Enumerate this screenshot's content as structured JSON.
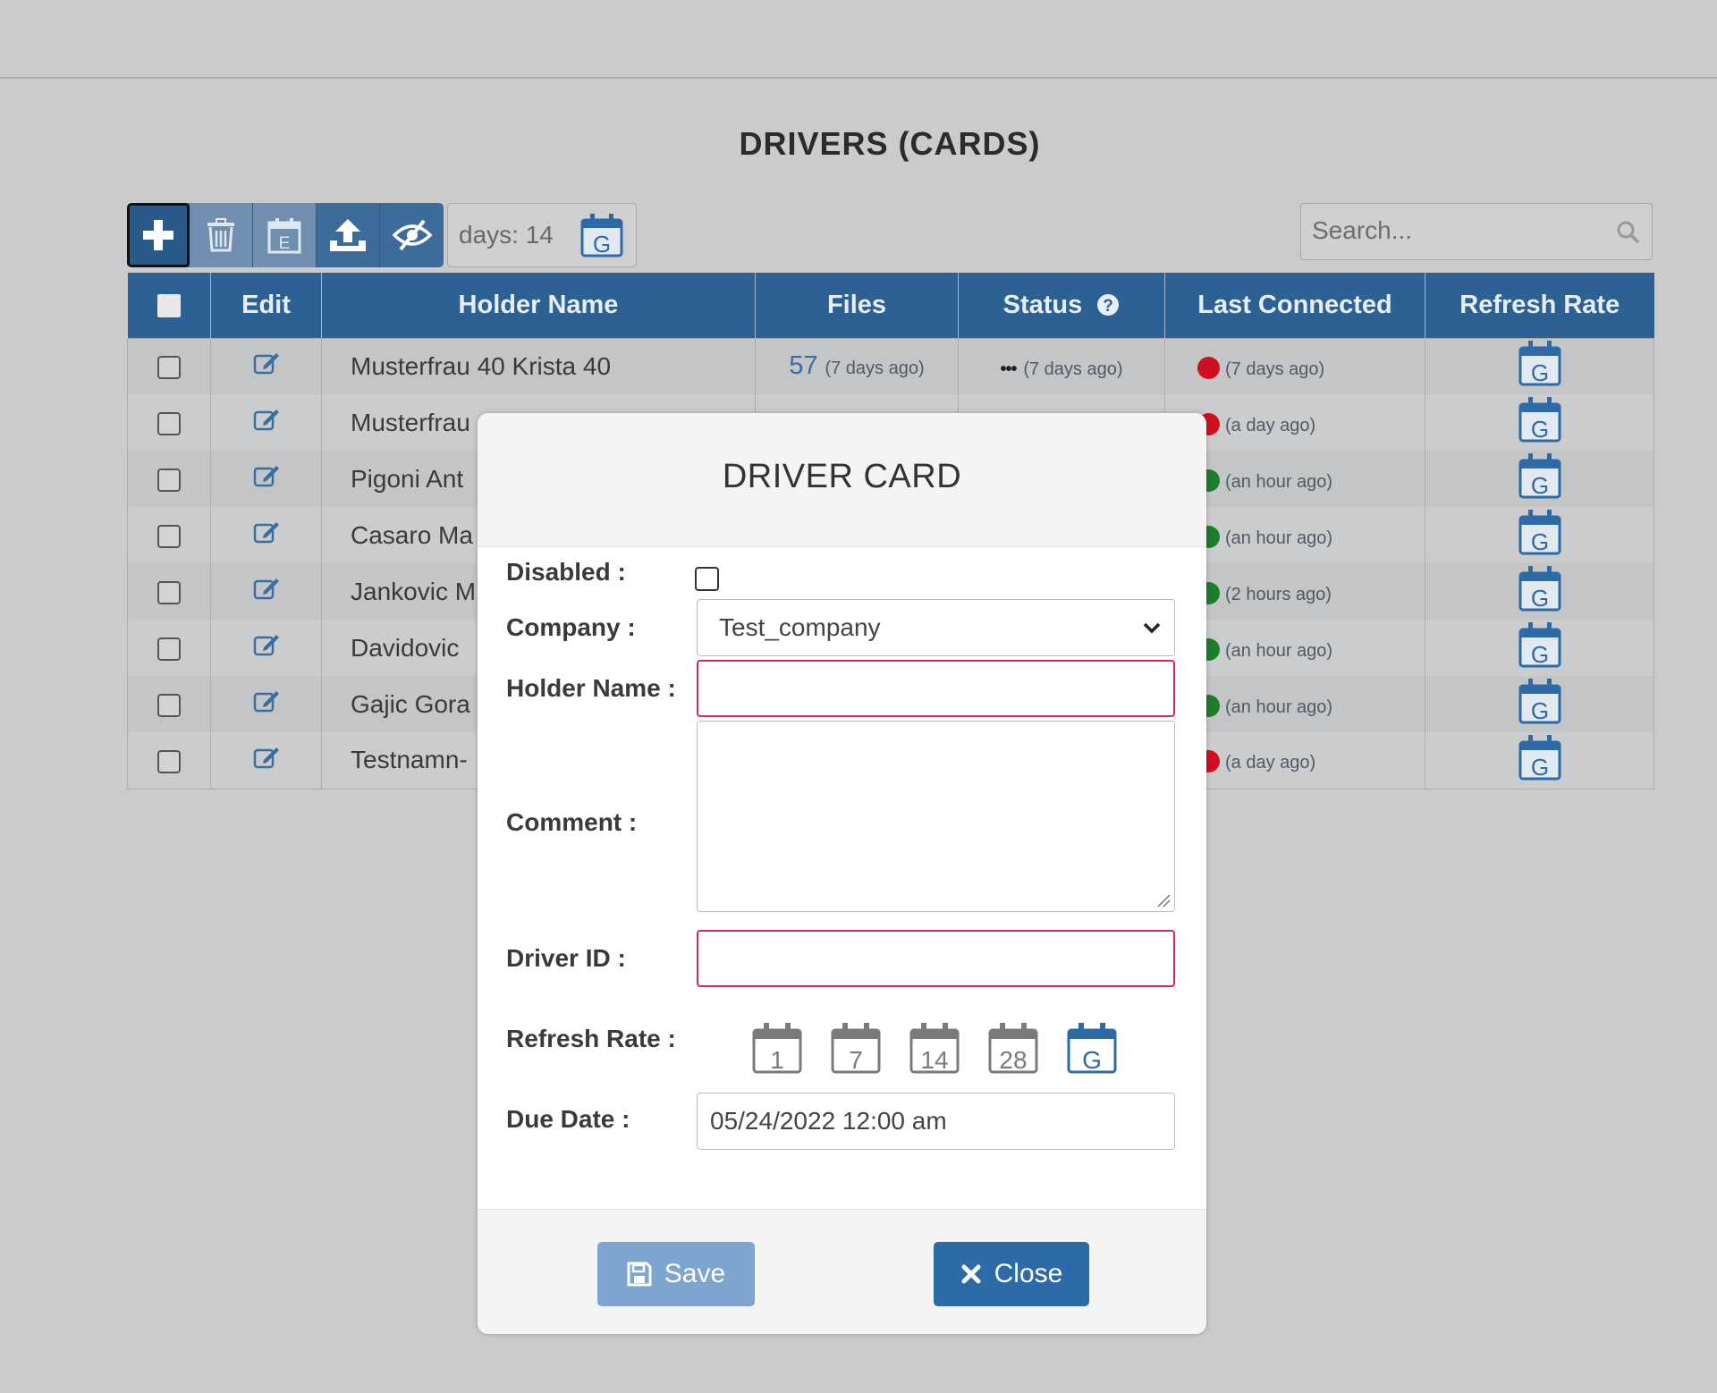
{
  "page": {
    "title": "DRIVERS (CARDS)"
  },
  "toolbar": {
    "days_label": "days: 14",
    "icons": [
      "plus-icon",
      "trash-icon",
      "calendar-e-icon",
      "upload-icon",
      "eye-slash-icon"
    ],
    "calendar_badge": "G"
  },
  "search": {
    "placeholder": "Search..."
  },
  "table": {
    "headers": [
      "Edit",
      "Holder Name",
      "Files",
      "Status",
      "Last Connected",
      "Refresh Rate"
    ],
    "refresh_badge": "G",
    "rows": [
      {
        "holder": "Musterfrau 40 Krista 40",
        "files": "57",
        "files_ago": "(7 days ago)",
        "status_ago": "(7 days ago)",
        "status_symbol": "•••",
        "last_ago": "(7 days ago)",
        "last_status": "red"
      },
      {
        "holder": "Musterfrau",
        "files": "",
        "files_ago": "",
        "status_ago": "",
        "status_symbol": "",
        "last_ago": "(a day ago)",
        "last_status": "red"
      },
      {
        "holder": "Pigoni Ant",
        "files": "",
        "files_ago": "",
        "status_ago": "",
        "status_symbol": "",
        "last_ago": "(an hour ago)",
        "last_status": "green"
      },
      {
        "holder": "Casaro Ma",
        "files": "",
        "files_ago": "",
        "status_ago": "",
        "status_symbol": "",
        "last_ago": "(an hour ago)",
        "last_status": "green"
      },
      {
        "holder": "Jankovic M",
        "files": "",
        "files_ago": "",
        "status_ago": "",
        "status_symbol": "",
        "last_ago": "(2 hours ago)",
        "last_status": "green"
      },
      {
        "holder": "Davidovic",
        "files": "",
        "files_ago": "",
        "status_ago": "",
        "status_symbol": "",
        "last_ago": "(an hour ago)",
        "last_status": "green"
      },
      {
        "holder": "Gajic Gora",
        "files": "",
        "files_ago": "",
        "status_ago": "",
        "status_symbol": "",
        "last_ago": "(an hour ago)",
        "last_status": "green"
      },
      {
        "holder": "Testnamn-",
        "files": "",
        "files_ago": "",
        "status_ago": "",
        "status_symbol": "",
        "last_ago": "(a day ago)",
        "last_status": "red"
      }
    ]
  },
  "modal": {
    "title": "DRIVER CARD",
    "labels": {
      "disabled": "Disabled :",
      "company": "Company :",
      "holder_name": "Holder Name :",
      "comment": "Comment :",
      "driver_id": "Driver ID :",
      "refresh_rate": "Refresh Rate :",
      "due_date": "Due Date :"
    },
    "values": {
      "company": "Test_company",
      "holder_name": "",
      "comment": "",
      "driver_id": "",
      "due_date": "05/24/2022 12:00 am"
    },
    "refresh_options": [
      "1",
      "7",
      "14",
      "28",
      "G"
    ],
    "refresh_selected": "G",
    "save_label": "Save",
    "close_label": "Close"
  },
  "colors": {
    "header_blue": "#2e6193",
    "accent_blue": "#2d6aa8",
    "invalid_pink": "#d2256a",
    "dot_red": "#d0101e",
    "dot_green": "#1d7d2a"
  }
}
